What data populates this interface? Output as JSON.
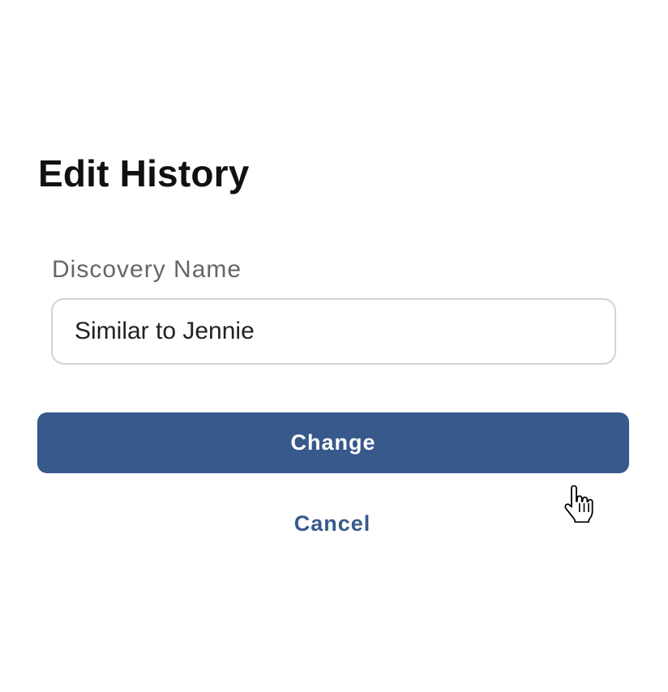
{
  "dialog": {
    "title": "Edit History",
    "field": {
      "label": "Discovery Name",
      "value": "Similar to Jennie"
    },
    "primary_button_label": "Change",
    "cancel_label": "Cancel"
  },
  "colors": {
    "accent": "#37598b",
    "title_text": "#111111",
    "label_text": "#666666",
    "input_border": "#d4d4d4",
    "background": "#ffffff"
  },
  "icons": {
    "cursor": "hand-pointer-cursor-icon"
  }
}
